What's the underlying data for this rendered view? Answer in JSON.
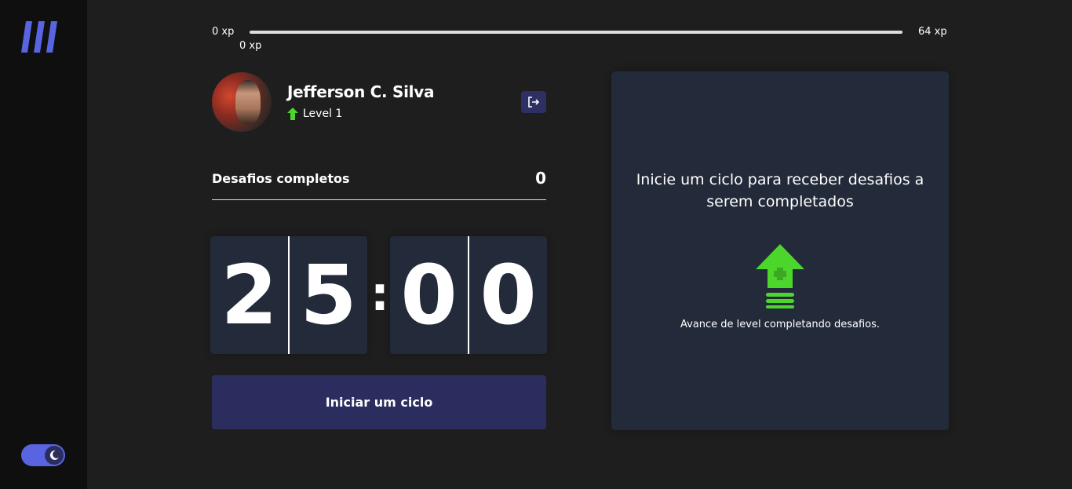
{
  "sidebar": {
    "logo_icon": "moveit-logo-icon",
    "theme_toggle_icon": "moon-icon"
  },
  "experience_bar": {
    "start_label": "0 xp",
    "end_label": "64 xp",
    "current_label": "0 xp",
    "progress_fraction": 0
  },
  "profile": {
    "name": "Jefferson C. Silva",
    "level_label": "Level 1",
    "level_icon": "level-up-arrow-icon",
    "logout_icon": "logout-icon"
  },
  "challenges": {
    "label": "Desafios completos",
    "count": "0"
  },
  "countdown": {
    "minute_left": "2",
    "minute_right": "5",
    "separator": ":",
    "second_left": "0",
    "second_right": "0"
  },
  "actions": {
    "start_cycle_label": "Iniciar um ciclo"
  },
  "challenge_box": {
    "title": "Inicie um ciclo para receber desafios a serem completados",
    "hint": "Avance de level completando desafios.",
    "icon": "level-up-icon"
  },
  "colors": {
    "accent": "#5965e0",
    "button": "#2b2d5e",
    "success": "#4cd62b",
    "card": "#232a3a",
    "background": "#1e1e1e",
    "sidebar": "#0f0f0f"
  }
}
